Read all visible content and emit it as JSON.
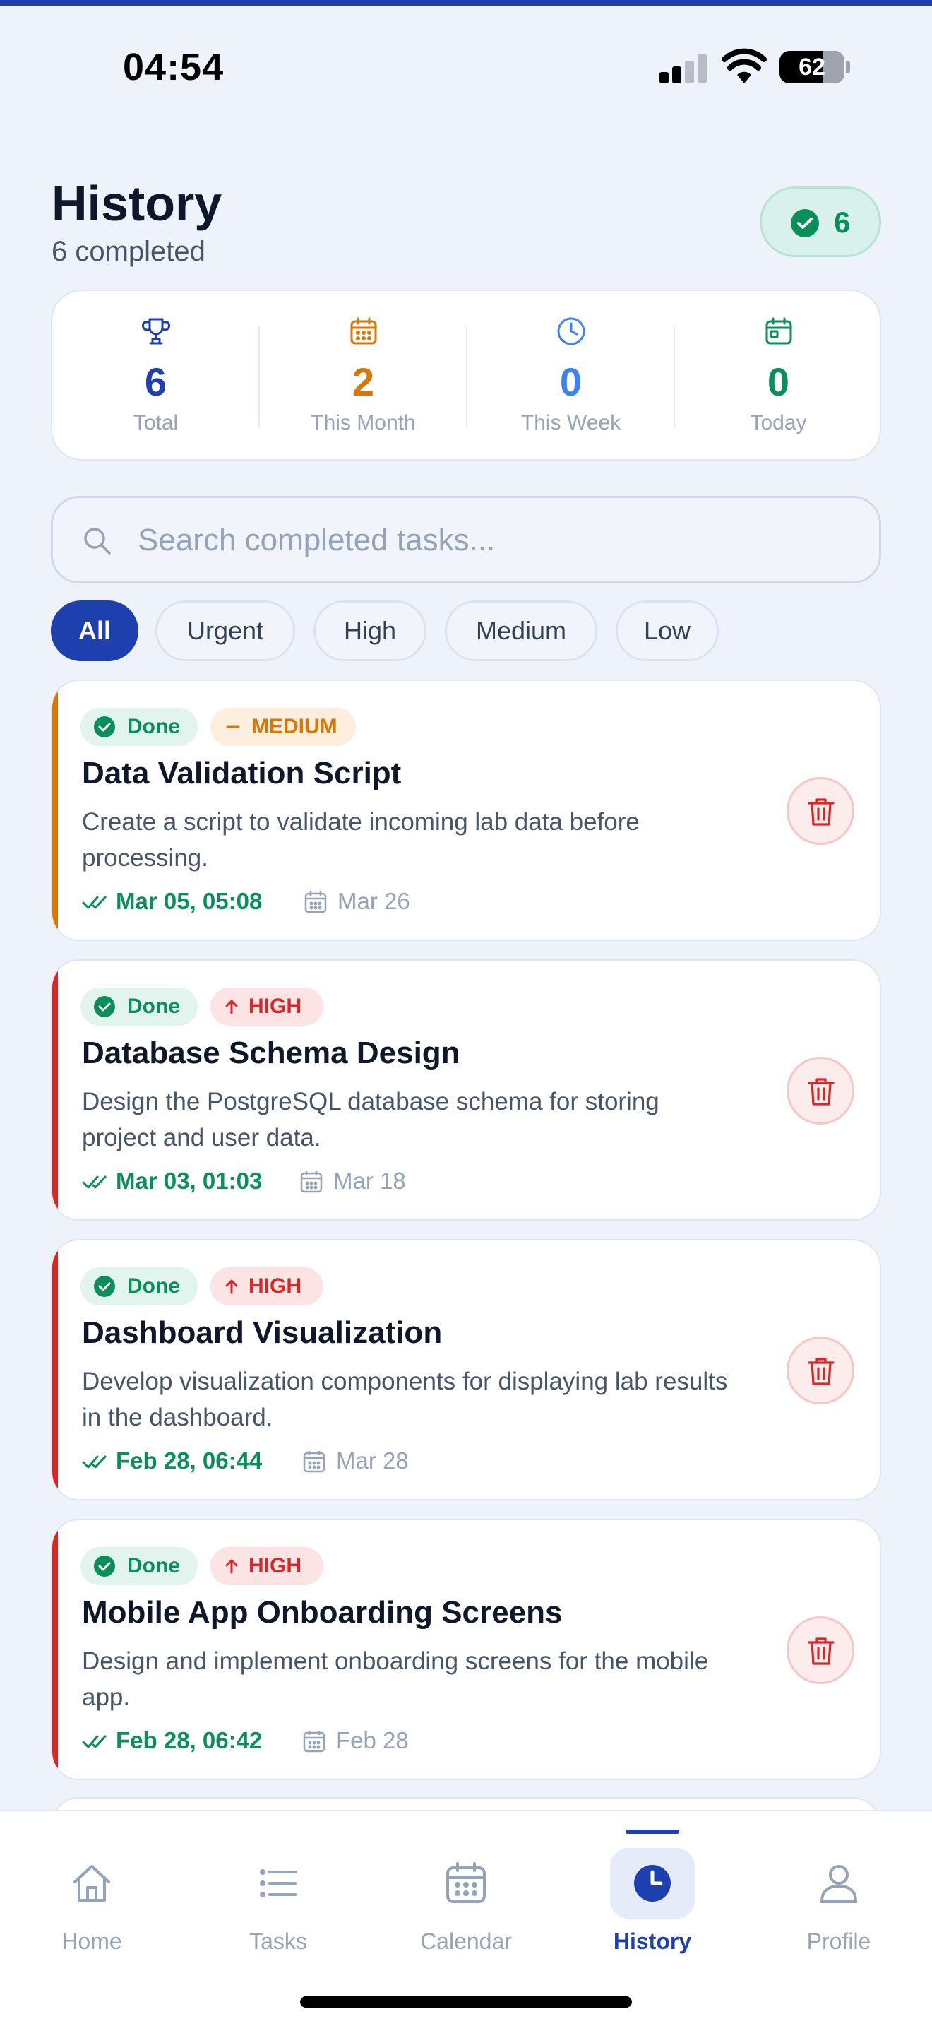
{
  "status_bar": {
    "time": "04:54",
    "battery": "62"
  },
  "header": {
    "title": "History",
    "subtitle": "6 completed",
    "completed_count": "6"
  },
  "stats": [
    {
      "value": "6",
      "label": "Total",
      "color": "#1e40af",
      "icon": "trophy-icon"
    },
    {
      "value": "2",
      "label": "This Month",
      "color": "#d97706",
      "icon": "calendar-month-icon"
    },
    {
      "value": "0",
      "label": "This Week",
      "color": "#3b82f6",
      "icon": "clock-icon"
    },
    {
      "value": "0",
      "label": "Today",
      "color": "#0a8f5b",
      "icon": "calendar-today-icon"
    }
  ],
  "search": {
    "placeholder": "Search completed tasks...",
    "value": ""
  },
  "filters": {
    "active": "All",
    "items": [
      "All",
      "Urgent",
      "High",
      "Medium",
      "Low"
    ]
  },
  "tasks": [
    {
      "status": "Done",
      "priority": "MEDIUM",
      "priority_color": "#d97706",
      "title": "Data Validation Script",
      "description": "Create a script to validate incoming lab data before processing.",
      "completed_at": "Mar 05, 05:08",
      "due": "Mar 26"
    },
    {
      "status": "Done",
      "priority": "HIGH",
      "priority_color": "#dc2626",
      "title": "Database Schema Design",
      "description": "Design the PostgreSQL database schema for storing project and user data.",
      "completed_at": "Mar 03, 01:03",
      "due": "Mar 18"
    },
    {
      "status": "Done",
      "priority": "HIGH",
      "priority_color": "#dc2626",
      "title": "Dashboard Visualization",
      "description": "Develop visualization components for displaying lab results in the dashboard.",
      "completed_at": "Feb 28, 06:44",
      "due": "Mar 28"
    },
    {
      "status": "Done",
      "priority": "HIGH",
      "priority_color": "#dc2626",
      "title": "Mobile App Onboarding Screens",
      "description": "Design and implement onboarding screens for the mobile app.",
      "completed_at": "Feb 28, 06:42",
      "due": "Feb 28"
    }
  ],
  "nav": {
    "active": "History",
    "items": [
      {
        "label": "Home",
        "icon": "home-icon"
      },
      {
        "label": "Tasks",
        "icon": "list-icon"
      },
      {
        "label": "Calendar",
        "icon": "calendar-icon"
      },
      {
        "label": "History",
        "icon": "history-clock-icon"
      },
      {
        "label": "Profile",
        "icon": "profile-icon"
      }
    ]
  },
  "colors": {
    "primary": "#1e40af",
    "success": "#0a8f5b",
    "medium": "#d97706",
    "high": "#dc2626"
  }
}
